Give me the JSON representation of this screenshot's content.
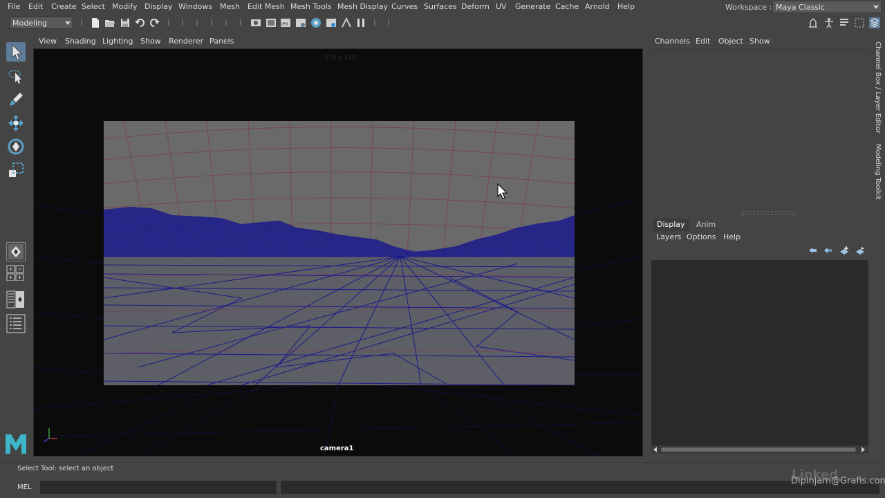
{
  "menubar": {
    "items": [
      "File",
      "Edit",
      "Create",
      "Select",
      "Modify",
      "Display",
      "Windows",
      "Mesh",
      "Edit Mesh",
      "Mesh Tools",
      "Mesh Display",
      "Curves",
      "Surfaces",
      "Deform",
      "UV",
      "Generate",
      "Cache",
      "Arnold",
      "Help"
    ],
    "workspace_label": "Workspace :",
    "workspace_value": "Maya Classic"
  },
  "statusline": {
    "mode_value": "Modeling"
  },
  "viewport": {
    "menus": [
      "View",
      "Shading",
      "Lighting",
      "Show",
      "Renderer",
      "Panels"
    ],
    "resolution": "570 x 320",
    "camera": "camera1",
    "colors": {
      "wireframe": "#1a1a8c",
      "grid": "#7a3f55",
      "film_gate_bg": "#6a6a6a"
    }
  },
  "channel_box": {
    "menus": [
      "Channels",
      "Edit",
      "Object",
      "Show"
    ]
  },
  "layer_editor": {
    "tabs": [
      "Display",
      "Anim"
    ],
    "menus": [
      "Layers",
      "Options",
      "Help"
    ]
  },
  "side_tabs": [
    "Channel Box / Layer Editor",
    "Modeling Toolkit"
  ],
  "helpline": {
    "text": "Select Tool: select an object"
  },
  "cmdline": {
    "label": "MEL"
  },
  "watermark": {
    "text": "Dipinjam@Grafis.com"
  },
  "logo": {
    "text": "Linked"
  },
  "accent": "#5d7c99"
}
